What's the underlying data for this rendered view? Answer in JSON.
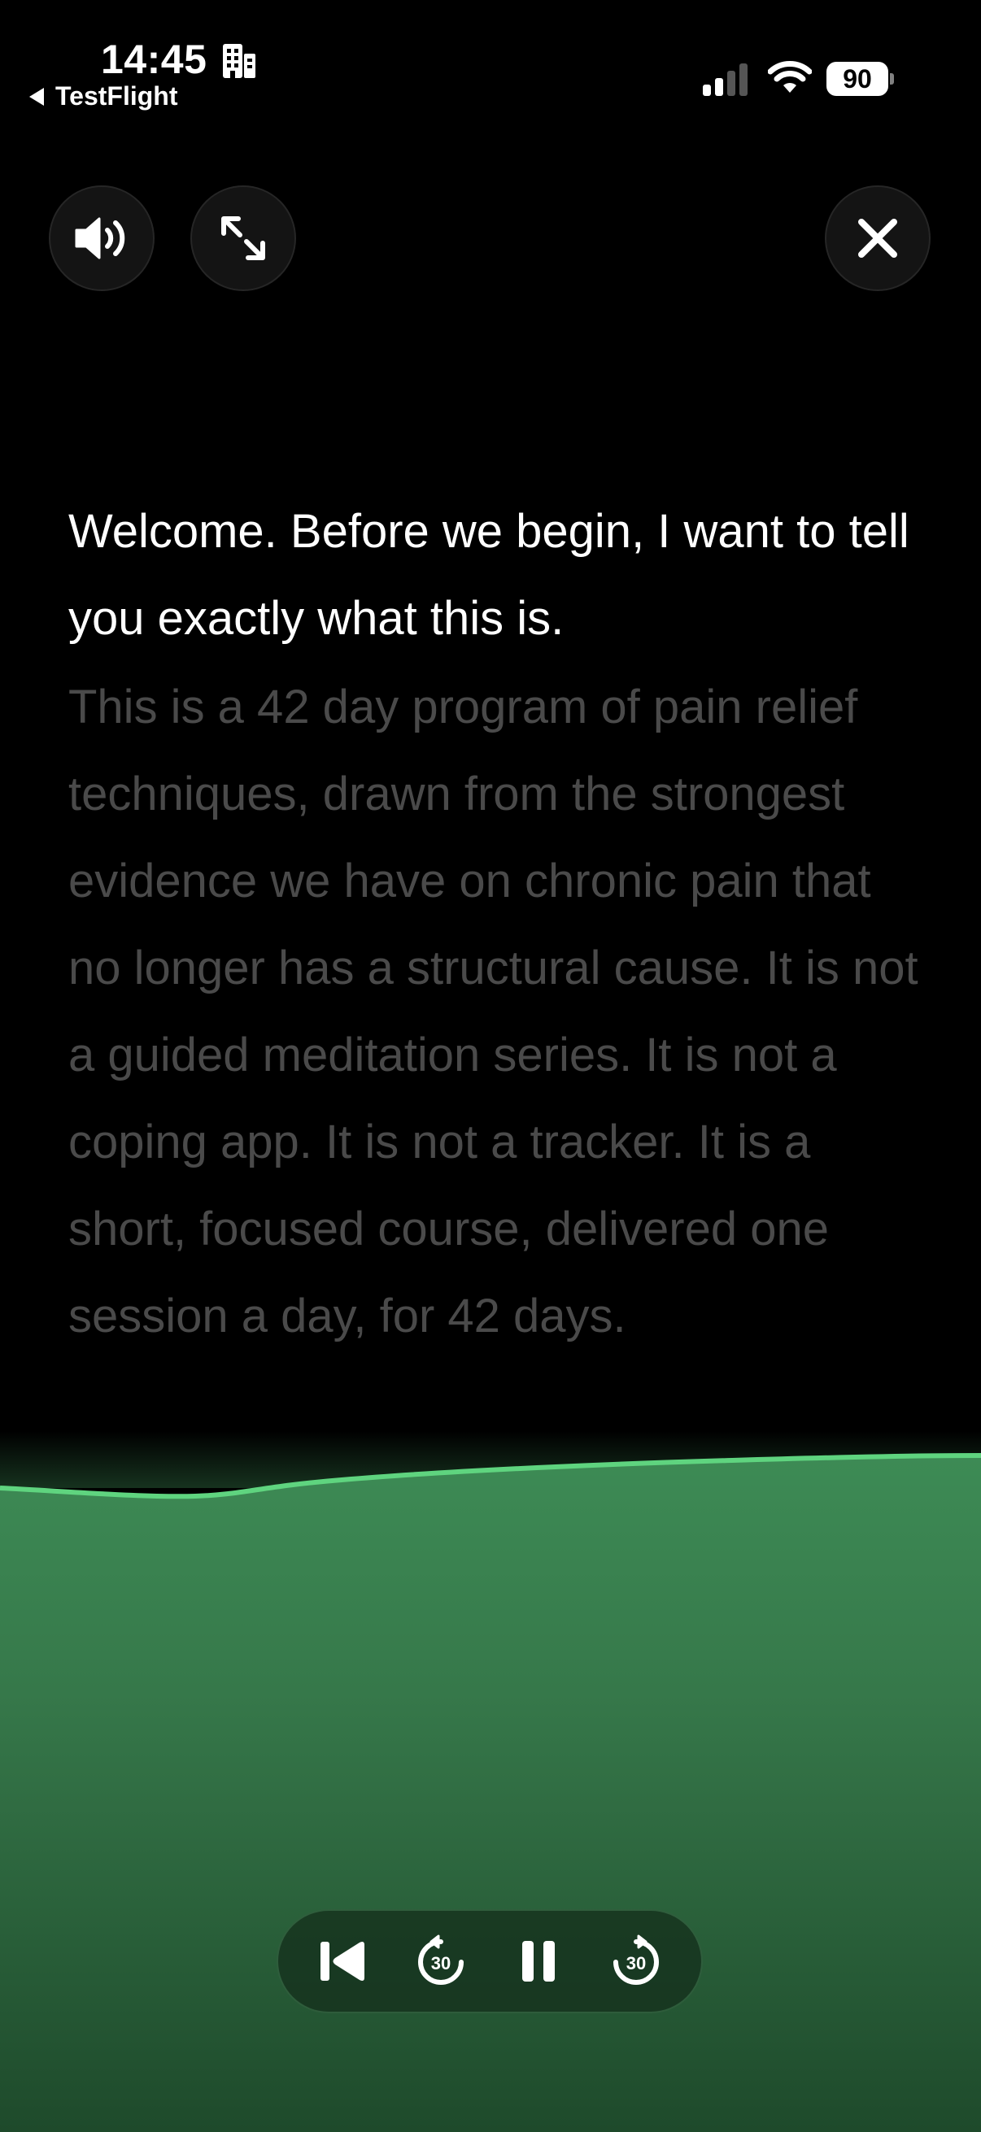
{
  "status_bar": {
    "time": "14:45",
    "back_app": "TestFlight",
    "battery": "90"
  },
  "icons": {
    "sound": "speaker-wave-icon",
    "expand": "expand-arrows-icon",
    "close": "close-x-icon",
    "previous": "skip-to-start-icon",
    "rewind": "rewind-30-icon",
    "pause": "pause-icon",
    "forward": "forward-30-icon"
  },
  "transcript": {
    "current": "Welcome. Before we begin, I want to tell you exactly what this is.",
    "upcoming": "This is a 42 day program of pain relief techniques, drawn from the strongest evidence we have on chronic pain that no longer has a structural cause. It is not a guided meditation series. It is not a coping app. It is not a tracker. It is a short, focused course, delivered one session a day, for 42 days."
  },
  "player": {
    "rewind_label": "30",
    "forward_label": "30"
  },
  "colors": {
    "background": "#000000",
    "wave_line": "#5fd47f",
    "wave_fill_top": "#3d8b55",
    "wave_fill_bottom": "#1e4a2b"
  }
}
